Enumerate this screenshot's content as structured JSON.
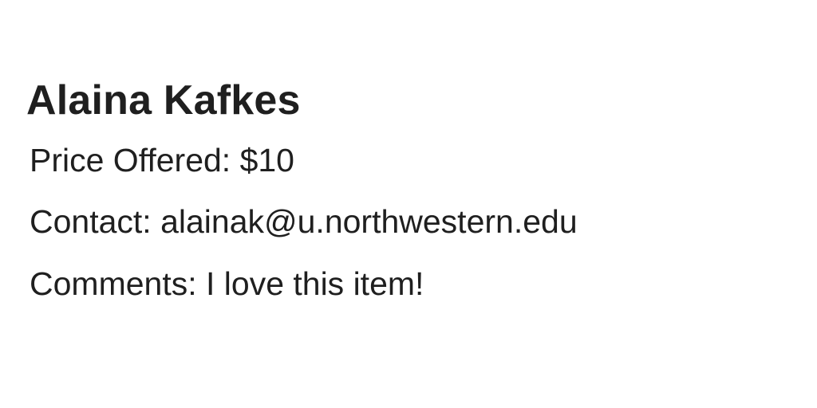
{
  "bid": {
    "name": "Alaina Kafkes",
    "price_offered": "Price Offered: $10",
    "contact": "Contact: alainak@u.northwestern.edu",
    "comments": "Comments: I love this item!"
  },
  "colors": {
    "background": "#ffffff",
    "text": "#1f1f1f"
  }
}
